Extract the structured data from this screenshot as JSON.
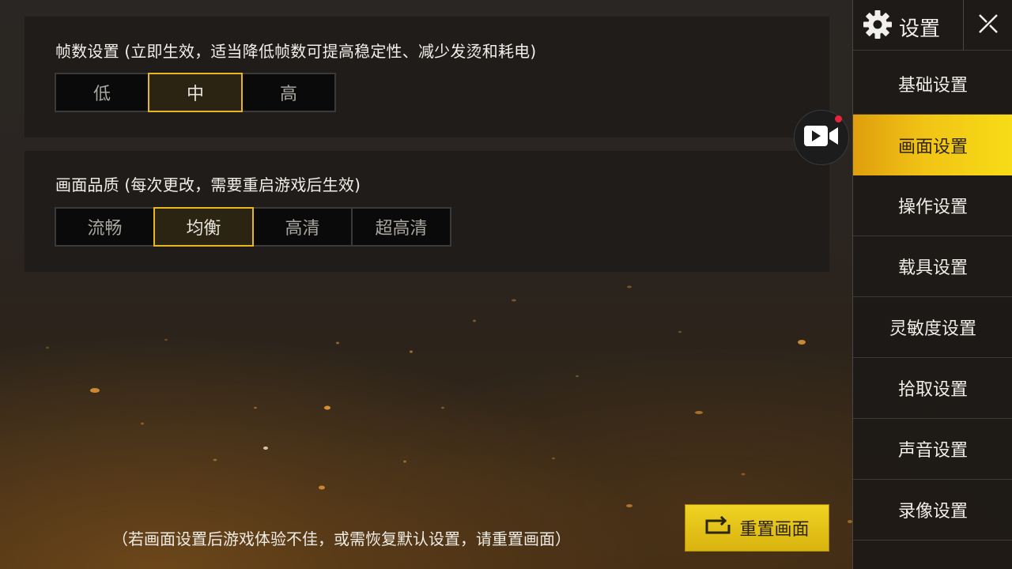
{
  "frame_rate": {
    "title": "帧数设置 (立即生效，适当降低帧数可提高稳定性、减少发烫和耗电)",
    "options": [
      "低",
      "中",
      "高"
    ],
    "selected": "中"
  },
  "graphics_quality": {
    "title": "画面品质 (每次更改，需要重启游戏后生效)",
    "options": [
      "流畅",
      "均衡",
      "高清",
      "超高清"
    ],
    "selected": "均衡"
  },
  "footer": {
    "note": "（若画面设置后游戏体验不佳，或需恢复默认设置，请重置画面）",
    "reset_label": "重置画面"
  },
  "sidebar": {
    "title": "设置",
    "items": [
      {
        "label": "基础设置"
      },
      {
        "label": "画面设置",
        "active": true
      },
      {
        "label": "操作设置"
      },
      {
        "label": "载具设置"
      },
      {
        "label": "灵敏度设置"
      },
      {
        "label": "拾取设置"
      },
      {
        "label": "声音设置"
      },
      {
        "label": "录像设置"
      }
    ]
  },
  "icons": {
    "gear": "gear-icon",
    "close": "close-icon",
    "video": "video-camera-icon",
    "reset": "reset-icon"
  },
  "colors": {
    "accent_yellow": "#f1c415",
    "selected_border": "#e8b61e",
    "record_dot": "#e8233a"
  }
}
